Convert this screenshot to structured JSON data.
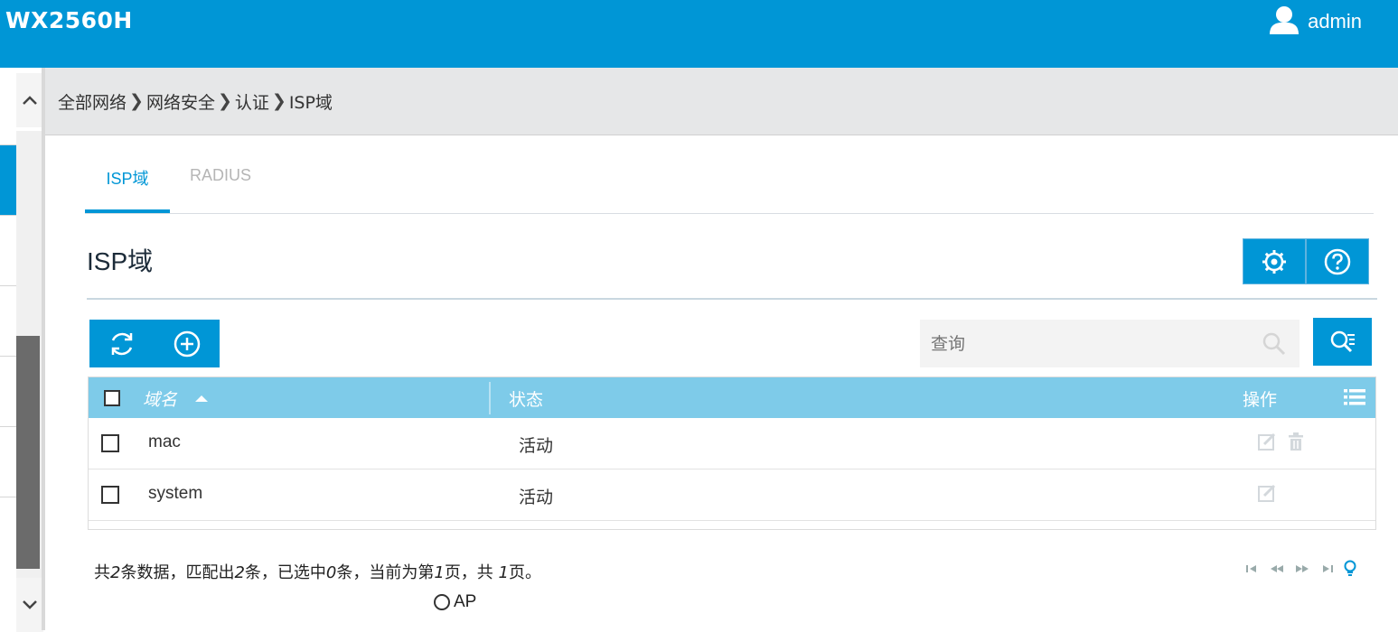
{
  "header": {
    "device_name": "WX2560H",
    "user_name": "admin"
  },
  "breadcrumb": {
    "items": [
      "全部网络",
      "网络安全",
      "认证",
      "ISP域"
    ],
    "separator": "❯"
  },
  "tabs": [
    {
      "label": "ISP域",
      "active": true
    },
    {
      "label": "RADIUS",
      "active": false
    }
  ],
  "section": {
    "title": "ISP域"
  },
  "search": {
    "placeholder": "查询"
  },
  "table": {
    "columns": {
      "name": "域名",
      "status": "状态",
      "operation": "操作"
    },
    "rows": [
      {
        "name": "mac",
        "status": "活动",
        "actions": [
          "edit-icon",
          "delete-icon"
        ]
      },
      {
        "name": "system",
        "status": "活动",
        "actions": [
          "edit-icon"
        ]
      }
    ]
  },
  "pagination": {
    "prefix": "共",
    "total": "2",
    "t1": "条数据，匹配出",
    "matched": "2",
    "t2": "条，已选中",
    "selected": "0",
    "t3": "条，当前为第",
    "page": "1",
    "t4": "页，共 ",
    "pages": "1",
    "t5": "页。"
  },
  "footer": {
    "ap_label": "AP"
  },
  "colors": {
    "brand": "#0096d6",
    "table_header": "#7ecbe9"
  }
}
